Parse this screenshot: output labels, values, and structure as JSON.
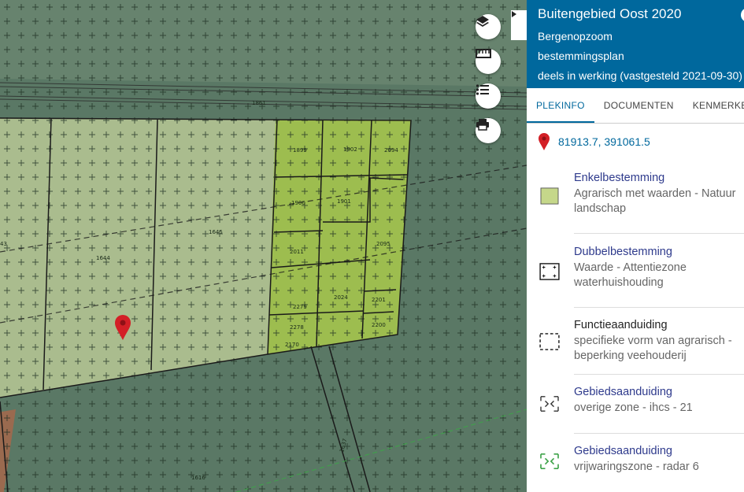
{
  "panel": {
    "title": "Buitengebied Oost 2020",
    "municipality": "Bergenopzoom",
    "plan_type": "bestemmingsplan",
    "status": "deels in werking (vastgesteld 2021-09-30)"
  },
  "tabs": [
    "PLEKINFO",
    "DOCUMENTEN",
    "KENMERKEN"
  ],
  "coordinates": "81913.7, 391061.5",
  "items": [
    {
      "heading": "Enkelbestemming",
      "description": [
        "Agrarisch met waarden - Natuur",
        "landschap"
      ]
    },
    {
      "heading": "Dubbelbestemming",
      "description": [
        "Waarde - Attentiezone",
        "waterhuishouding"
      ]
    },
    {
      "heading": "Functieaanduiding",
      "description": [
        "specifieke vorm van agrarisch -",
        "beperking veehouderij"
      ]
    },
    {
      "heading": "Gebiedsaanduiding",
      "description": [
        "overige zone - ihcs - 21"
      ]
    },
    {
      "heading": "Gebiedsaanduiding",
      "description": [
        "vrijwaringszone - radar 6"
      ]
    }
  ],
  "map": {
    "parcels": [
      "1861",
      "1899",
      "1902",
      "2094",
      "1900",
      "1901",
      "2011",
      "2095",
      "2279",
      "2024",
      "2201",
      "2278",
      "2200",
      "2170",
      "1644",
      "1645",
      "1637",
      "1616",
      "43"
    ],
    "tools": [
      "layers-icon",
      "ruler-icon",
      "legend-icon",
      "print-icon"
    ]
  },
  "colors": {
    "header": "#00689d",
    "link": "#2e3a8c",
    "marker": "#d31f26",
    "agri_landscape": "#c5d78a"
  }
}
